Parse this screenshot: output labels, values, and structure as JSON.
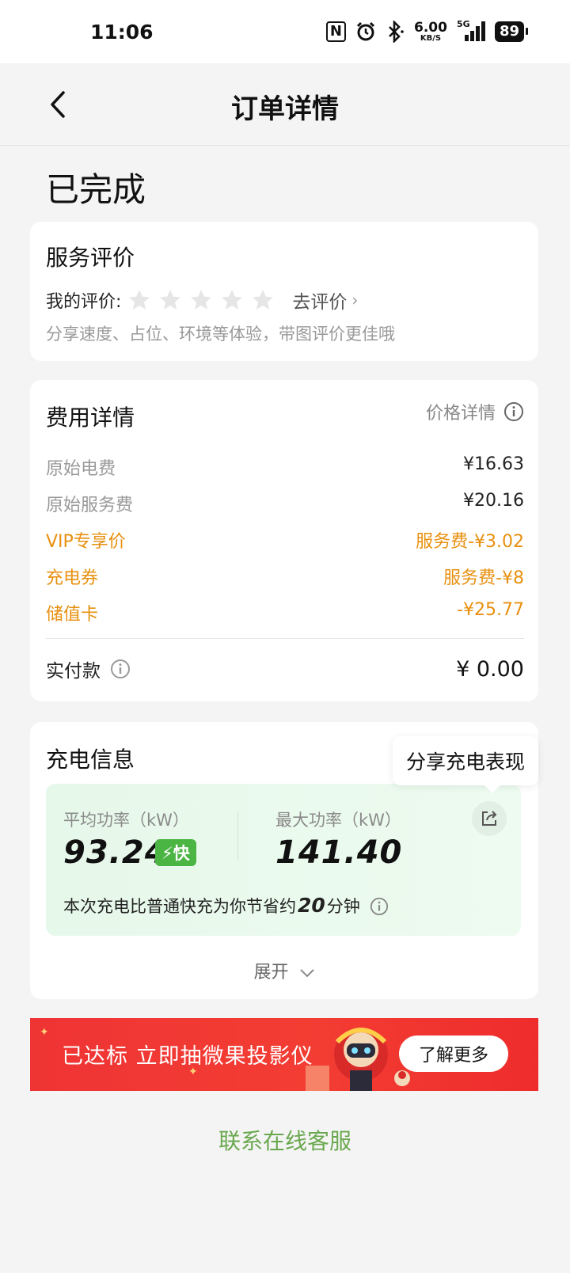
{
  "status_bar": {
    "time": "11:06",
    "nfc": "N",
    "speed_value": "6.00",
    "speed_unit": "KB/S",
    "network": "5G",
    "battery": "89"
  },
  "nav": {
    "title": "订单详情"
  },
  "order_status": "已完成",
  "rating": {
    "title": "服务评价",
    "my_rating_label": "我的评价:",
    "stars_filled": 0,
    "stars_total": 5,
    "go_rate": "去评价",
    "hint": "分享速度、占位、环境等体验，带图评价更佳哦"
  },
  "fees": {
    "title": "费用详情",
    "price_detail": "价格详情",
    "rows": [
      {
        "label": "原始电费",
        "value": "¥16.63"
      },
      {
        "label": "原始服务费",
        "value": "¥20.16"
      },
      {
        "label": "VIP专享价",
        "value": "服务费-¥3.02"
      },
      {
        "label": "充电券",
        "value": "服务费-¥8"
      },
      {
        "label": "储值卡",
        "value": "-¥25.77"
      }
    ],
    "paid_label": "实付款",
    "paid_value": "¥ 0.00"
  },
  "charging": {
    "title": "充电信息",
    "avg_label": "平均功率（kW）",
    "avg_value": "93.24",
    "fast_badge": "⚡快",
    "max_label": "最大功率（kW）",
    "max_value": "141.40",
    "save_prefix": "本次充电比普通快充为你节省约",
    "save_minutes": "20",
    "save_suffix": "分钟",
    "expand": "展开",
    "share_tooltip": "分享充电表现"
  },
  "banner": {
    "text": "已达标 立即抽微果投影仪",
    "button": "了解更多"
  },
  "contact": "联系在线客服",
  "colors": {
    "orange": "#e8900f",
    "green": "#6aa84f",
    "badge_green": "#4bb544",
    "banner_red": "#ef3434"
  }
}
